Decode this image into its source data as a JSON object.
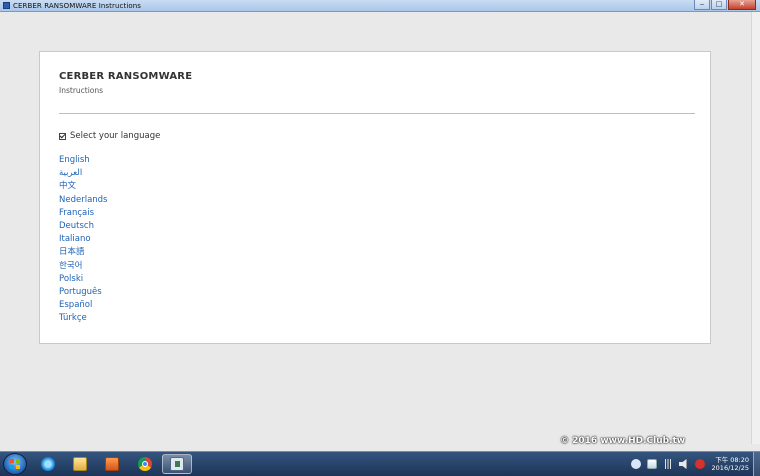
{
  "window": {
    "title": "CERBER RANSOMWARE Instructions",
    "minimize_label": "‒",
    "maximize_label": "□",
    "close_label": "✕"
  },
  "page": {
    "heading": "CERBER RANSOMWARE",
    "subheading": "Instructions",
    "language_prompt": "Select your language",
    "languages": [
      "English",
      "العربية",
      "中文",
      "Nederlands",
      "Français",
      "Deutsch",
      "Italiano",
      "日本語",
      "한국어",
      "Polski",
      "Português",
      "Español",
      "Türkçe"
    ]
  },
  "taskbar": {
    "pinned": [
      {
        "name": "ie-icon"
      },
      {
        "name": "folder-icon"
      },
      {
        "name": "media-player-icon"
      },
      {
        "name": "chrome-icon"
      },
      {
        "name": "app-window-icon"
      }
    ],
    "watermark": "© 2016 www.HD.Club.tw",
    "clock_time": "下午 08:20",
    "clock_date": "2016/12/25"
  },
  "colors": {
    "link": "#1f63b5",
    "taskbar": "#1c3457",
    "background": "#e9e9e9"
  }
}
